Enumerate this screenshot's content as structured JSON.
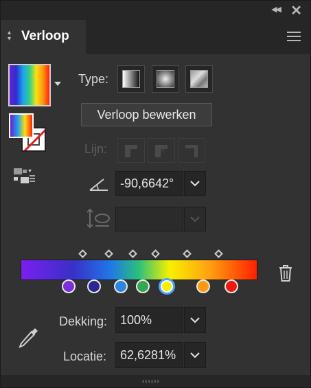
{
  "header": {
    "collapse_icon": "double-chevron-left-icon",
    "close_icon": "close-icon"
  },
  "tab": {
    "title": "Verloop",
    "menu_icon": "hamburger-menu-icon"
  },
  "type": {
    "label": "Type:",
    "buttons": [
      {
        "name": "linear-gradient-button"
      },
      {
        "name": "radial-gradient-button"
      },
      {
        "name": "freeform-gradient-button"
      }
    ]
  },
  "edit_button": "Verloop bewerken",
  "stroke": {
    "label": "Lijn:"
  },
  "angle": {
    "value": "-90,6642°"
  },
  "aspect": {
    "value": ""
  },
  "gradient": {
    "colors": [
      "#7a1ff0",
      "#3830c8",
      "#1f78e8",
      "#2cc07a",
      "#f8f000",
      "#ffa010",
      "#ff2000"
    ],
    "stops": [
      {
        "color": "#7a2fd8",
        "location": 20
      },
      {
        "color": "#2a2890",
        "location": 31
      },
      {
        "color": "#2a86e0",
        "location": 43
      },
      {
        "color": "#34a850",
        "location": 52
      },
      {
        "color": "#f8f000",
        "location": 62.6281,
        "selected": true
      },
      {
        "color": "#ff9a10",
        "location": 78
      },
      {
        "color": "#ee1a10",
        "location": 90
      }
    ]
  },
  "opacity": {
    "label": "Dekking:",
    "value": "100%"
  },
  "location": {
    "label": "Locatie:",
    "value": "62,6281%"
  }
}
